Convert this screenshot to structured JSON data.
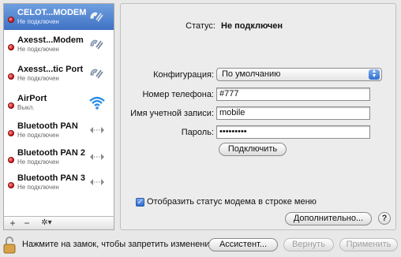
{
  "services": [
    {
      "name": "CELOT...MODEM",
      "status": "Не подключен",
      "icon": "phone-icon",
      "selected": true
    },
    {
      "name": "Axesst...Modem",
      "status": "Не подключен",
      "icon": "phone-icon",
      "selected": false
    },
    {
      "name": "Axesst...tic Port",
      "status": "Не подключен",
      "icon": "phone-icon",
      "selected": false
    },
    {
      "name": "AirPort",
      "status": "Выкл.",
      "icon": "wifi-icon",
      "selected": false
    },
    {
      "name": "Bluetooth PAN",
      "status": "Не подключен",
      "icon": "connection-arrows-icon",
      "selected": false
    },
    {
      "name": "Bluetooth PAN 2",
      "status": "Не подключен",
      "icon": "connection-arrows-icon",
      "selected": false
    },
    {
      "name": "Bluetooth PAN 3",
      "status": "Не подключен",
      "icon": "connection-arrows-icon",
      "selected": false
    }
  ],
  "sidebar_tools": {
    "add": "+",
    "remove": "−",
    "action": "✲▾"
  },
  "detail": {
    "status_label": "Статус:",
    "status_value": "Не подключен",
    "config_label": "Конфигурация:",
    "config_value": "По умолчанию",
    "phone_label": "Номер телефона:",
    "phone_value": "#777",
    "account_label": "Имя учетной записи:",
    "account_value": "mobile",
    "password_label": "Пароль:",
    "password_value": "•••••••••",
    "connect_button": "Подключить",
    "show_status_checkbox": "Отобразить статус модема в строке меню",
    "show_status_checked": true,
    "advanced_button": "Дополнительно...",
    "help_button": "?"
  },
  "bottom": {
    "lock_text": "Нажмите на замок, чтобы запретить изменения.",
    "assistant_button": "Ассистент...",
    "revert_button": "Вернуть",
    "apply_button": "Применить"
  },
  "colors": {
    "status_dot": "#c21010",
    "selection": "#3f72c4",
    "accent": "#2f6fd0"
  }
}
